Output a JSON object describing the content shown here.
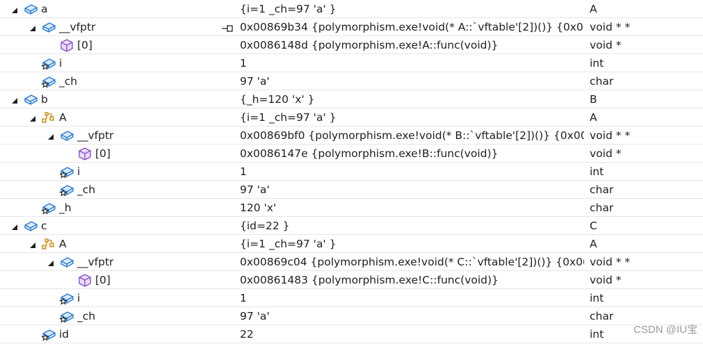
{
  "rows": [
    {
      "level": 0,
      "expand": "open",
      "icon": "field",
      "name": "a",
      "value": "{i=1 _ch=97 'a' }",
      "type": "A"
    },
    {
      "level": 1,
      "expand": "open",
      "icon": "field",
      "name": "__vfptr",
      "pin": true,
      "value": "0x00869b34 {polymorphism.exe!void(* A::`vftable'[2])()} {0x00...",
      "type": "void * *"
    },
    {
      "level": 2,
      "expand": "none",
      "icon": "method",
      "name": "[0]",
      "value": "0x0086148d {polymorphism.exe!A::func(void)}",
      "type": "void *"
    },
    {
      "level": 1,
      "expand": "none",
      "icon": "field-star",
      "name": "i",
      "value": "1",
      "type": "int"
    },
    {
      "level": 1,
      "expand": "none",
      "icon": "field-star",
      "name": "_ch",
      "value": "97 'a'",
      "type": "char"
    },
    {
      "level": 0,
      "expand": "open",
      "icon": "field",
      "name": "b",
      "value": "{_h=120 'x' }",
      "type": "B"
    },
    {
      "level": 1,
      "expand": "open",
      "icon": "base-class",
      "name": "A",
      "value": "{i=1 _ch=97 'a' }",
      "type": "A"
    },
    {
      "level": 2,
      "expand": "open",
      "icon": "field",
      "name": "__vfptr",
      "value": "0x00869bf0 {polymorphism.exe!void(* B::`vftable'[2])()} {0x00...",
      "type": "void * *"
    },
    {
      "level": 3,
      "expand": "none",
      "icon": "method",
      "name": "[0]",
      "value": "0x0086147e {polymorphism.exe!B::func(void)}",
      "type": "void *"
    },
    {
      "level": 2,
      "expand": "none",
      "icon": "field-star",
      "name": "i",
      "value": "1",
      "type": "int"
    },
    {
      "level": 2,
      "expand": "none",
      "icon": "field-star",
      "name": "_ch",
      "value": "97 'a'",
      "type": "char"
    },
    {
      "level": 1,
      "expand": "none",
      "icon": "field-star",
      "name": "_h",
      "value": "120 'x'",
      "type": "char"
    },
    {
      "level": 0,
      "expand": "open",
      "icon": "field",
      "name": "c",
      "value": "{id=22 }",
      "type": "C"
    },
    {
      "level": 1,
      "expand": "open",
      "icon": "base-class",
      "name": "A",
      "value": "{i=1 _ch=97 'a' }",
      "type": "A"
    },
    {
      "level": 2,
      "expand": "open",
      "icon": "field",
      "name": "__vfptr",
      "value": "0x00869c04 {polymorphism.exe!void(* C::`vftable'[2])()} {0x00...",
      "type": "void * *"
    },
    {
      "level": 3,
      "expand": "none",
      "icon": "method",
      "name": "[0]",
      "value": "0x00861483 {polymorphism.exe!C::func(void)}",
      "type": "void *"
    },
    {
      "level": 2,
      "expand": "none",
      "icon": "field-star",
      "name": "i",
      "value": "1",
      "type": "int"
    },
    {
      "level": 2,
      "expand": "none",
      "icon": "field-star",
      "name": "_ch",
      "value": "97 'a'",
      "type": "char"
    },
    {
      "level": 1,
      "expand": "none",
      "icon": "field-star",
      "name": "id",
      "value": "22",
      "type": "int"
    }
  ],
  "watermark": "CSDN @IU宝",
  "colors": {
    "field": "#2a78c8",
    "field_fill": "#d7e9fb",
    "method": "#8a4fc2",
    "method_fill": "#eadcf7",
    "base": "#c08a1e",
    "base_fill": "#f6e3b4"
  }
}
